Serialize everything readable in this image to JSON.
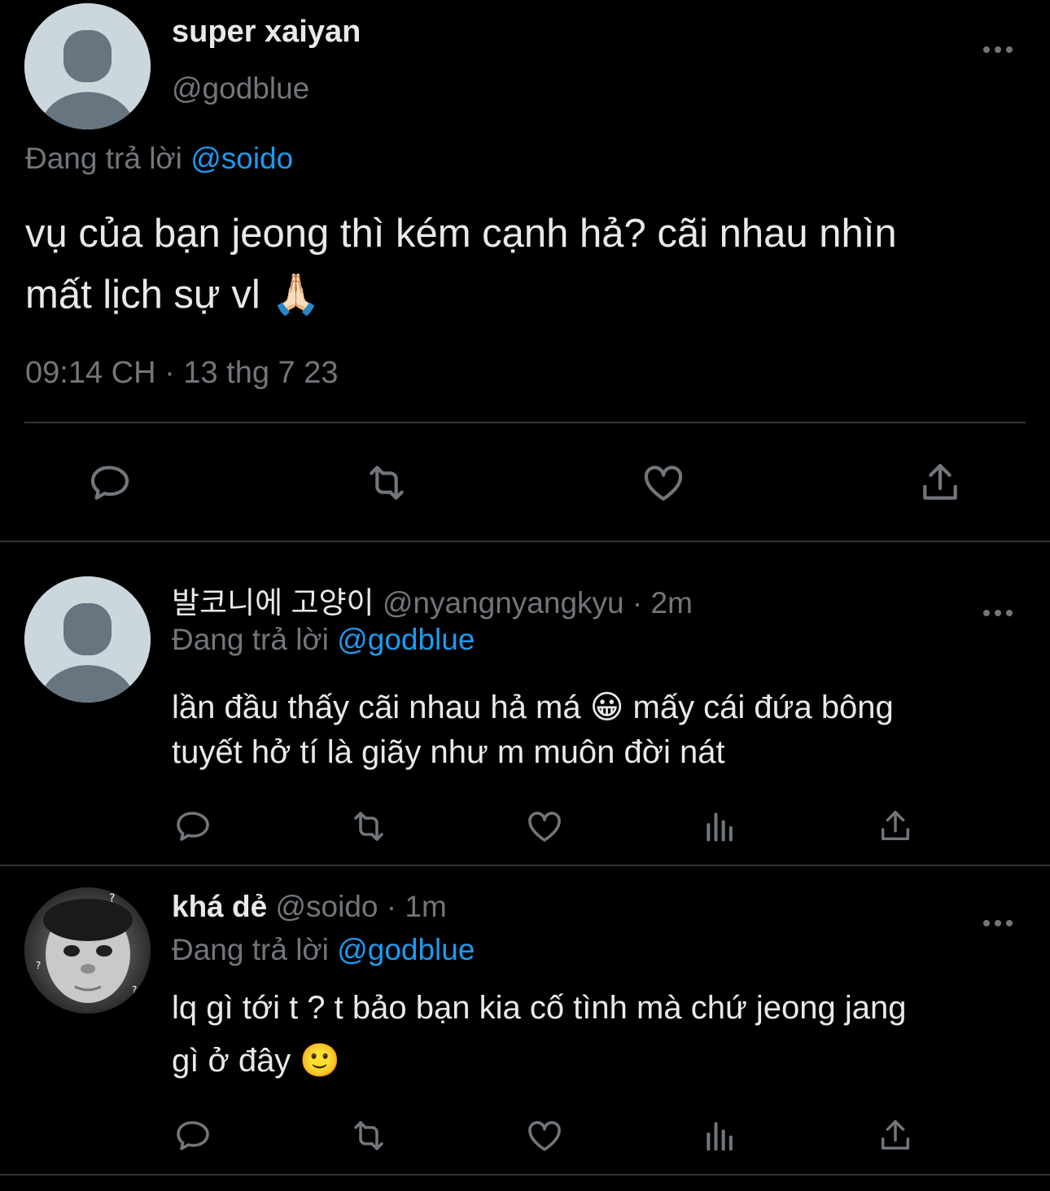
{
  "main_tweet": {
    "display_name": "super xaiyan",
    "handle": "@godblue",
    "reply_prefix": "Đang trả lời",
    "reply_to": "@soido",
    "text_line1": "vụ của bạn jeong thì kém cạnh hả? cãi nhau nhìn",
    "text_line2": "mất lịch sự vl 🙏🏻",
    "timestamp": "09:14 CH · 13 thg 7 23"
  },
  "replies": [
    {
      "display_name": "발코니에 고양이",
      "handle": "@nyangnyangkyu",
      "time": "· 2m",
      "reply_prefix": "Đang trả lời",
      "reply_to": "@godblue",
      "text_line1": "lần đầu thấy cãi nhau hả má 😀  mấy cái đứa bông",
      "text_line2": "tuyết hở tí là giãy như m muôn đời nát"
    },
    {
      "display_name": "khá dẻ",
      "handle": "@soido",
      "time": "· 1m",
      "reply_prefix": "Đang trả lời",
      "reply_to": "@godblue",
      "text_line1": "lq gì tới t ? t bảo bạn kia cố tình mà chứ jeong jang",
      "text_line2": "gì ở đây 🙂"
    }
  ],
  "icons": {
    "more": "more-horizontal-icon",
    "reply": "reply-icon",
    "retweet": "retweet-icon",
    "like": "heart-icon",
    "views": "analytics-icon",
    "share": "share-icon"
  },
  "colors": {
    "background": "#000000",
    "text": "#e7e9ea",
    "muted": "#71767b",
    "link": "#1d9bf0",
    "divider": "#2f3336"
  }
}
